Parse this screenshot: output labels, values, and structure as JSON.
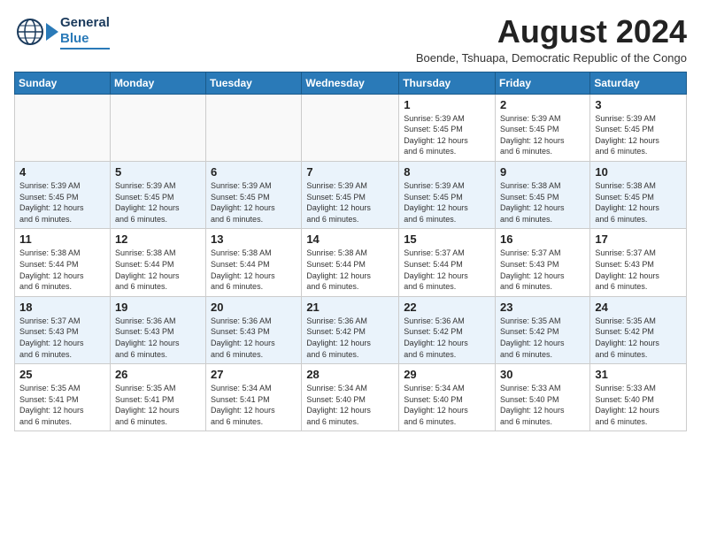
{
  "header": {
    "logo_general": "General",
    "logo_blue": "Blue",
    "month_title": "August 2024",
    "subtitle": "Boende, Tshuapa, Democratic Republic of the Congo"
  },
  "weekdays": [
    "Sunday",
    "Monday",
    "Tuesday",
    "Wednesday",
    "Thursday",
    "Friday",
    "Saturday"
  ],
  "weeks": [
    [
      {
        "day": "",
        "info": ""
      },
      {
        "day": "",
        "info": ""
      },
      {
        "day": "",
        "info": ""
      },
      {
        "day": "",
        "info": ""
      },
      {
        "day": "1",
        "info": "Sunrise: 5:39 AM\nSunset: 5:45 PM\nDaylight: 12 hours\nand 6 minutes."
      },
      {
        "day": "2",
        "info": "Sunrise: 5:39 AM\nSunset: 5:45 PM\nDaylight: 12 hours\nand 6 minutes."
      },
      {
        "day": "3",
        "info": "Sunrise: 5:39 AM\nSunset: 5:45 PM\nDaylight: 12 hours\nand 6 minutes."
      }
    ],
    [
      {
        "day": "4",
        "info": "Sunrise: 5:39 AM\nSunset: 5:45 PM\nDaylight: 12 hours\nand 6 minutes."
      },
      {
        "day": "5",
        "info": "Sunrise: 5:39 AM\nSunset: 5:45 PM\nDaylight: 12 hours\nand 6 minutes."
      },
      {
        "day": "6",
        "info": "Sunrise: 5:39 AM\nSunset: 5:45 PM\nDaylight: 12 hours\nand 6 minutes."
      },
      {
        "day": "7",
        "info": "Sunrise: 5:39 AM\nSunset: 5:45 PM\nDaylight: 12 hours\nand 6 minutes."
      },
      {
        "day": "8",
        "info": "Sunrise: 5:39 AM\nSunset: 5:45 PM\nDaylight: 12 hours\nand 6 minutes."
      },
      {
        "day": "9",
        "info": "Sunrise: 5:38 AM\nSunset: 5:45 PM\nDaylight: 12 hours\nand 6 minutes."
      },
      {
        "day": "10",
        "info": "Sunrise: 5:38 AM\nSunset: 5:45 PM\nDaylight: 12 hours\nand 6 minutes."
      }
    ],
    [
      {
        "day": "11",
        "info": "Sunrise: 5:38 AM\nSunset: 5:44 PM\nDaylight: 12 hours\nand 6 minutes."
      },
      {
        "day": "12",
        "info": "Sunrise: 5:38 AM\nSunset: 5:44 PM\nDaylight: 12 hours\nand 6 minutes."
      },
      {
        "day": "13",
        "info": "Sunrise: 5:38 AM\nSunset: 5:44 PM\nDaylight: 12 hours\nand 6 minutes."
      },
      {
        "day": "14",
        "info": "Sunrise: 5:38 AM\nSunset: 5:44 PM\nDaylight: 12 hours\nand 6 minutes."
      },
      {
        "day": "15",
        "info": "Sunrise: 5:37 AM\nSunset: 5:44 PM\nDaylight: 12 hours\nand 6 minutes."
      },
      {
        "day": "16",
        "info": "Sunrise: 5:37 AM\nSunset: 5:43 PM\nDaylight: 12 hours\nand 6 minutes."
      },
      {
        "day": "17",
        "info": "Sunrise: 5:37 AM\nSunset: 5:43 PM\nDaylight: 12 hours\nand 6 minutes."
      }
    ],
    [
      {
        "day": "18",
        "info": "Sunrise: 5:37 AM\nSunset: 5:43 PM\nDaylight: 12 hours\nand 6 minutes."
      },
      {
        "day": "19",
        "info": "Sunrise: 5:36 AM\nSunset: 5:43 PM\nDaylight: 12 hours\nand 6 minutes."
      },
      {
        "day": "20",
        "info": "Sunrise: 5:36 AM\nSunset: 5:43 PM\nDaylight: 12 hours\nand 6 minutes."
      },
      {
        "day": "21",
        "info": "Sunrise: 5:36 AM\nSunset: 5:42 PM\nDaylight: 12 hours\nand 6 minutes."
      },
      {
        "day": "22",
        "info": "Sunrise: 5:36 AM\nSunset: 5:42 PM\nDaylight: 12 hours\nand 6 minutes."
      },
      {
        "day": "23",
        "info": "Sunrise: 5:35 AM\nSunset: 5:42 PM\nDaylight: 12 hours\nand 6 minutes."
      },
      {
        "day": "24",
        "info": "Sunrise: 5:35 AM\nSunset: 5:42 PM\nDaylight: 12 hours\nand 6 minutes."
      }
    ],
    [
      {
        "day": "25",
        "info": "Sunrise: 5:35 AM\nSunset: 5:41 PM\nDaylight: 12 hours\nand 6 minutes."
      },
      {
        "day": "26",
        "info": "Sunrise: 5:35 AM\nSunset: 5:41 PM\nDaylight: 12 hours\nand 6 minutes."
      },
      {
        "day": "27",
        "info": "Sunrise: 5:34 AM\nSunset: 5:41 PM\nDaylight: 12 hours\nand 6 minutes."
      },
      {
        "day": "28",
        "info": "Sunrise: 5:34 AM\nSunset: 5:40 PM\nDaylight: 12 hours\nand 6 minutes."
      },
      {
        "day": "29",
        "info": "Sunrise: 5:34 AM\nSunset: 5:40 PM\nDaylight: 12 hours\nand 6 minutes."
      },
      {
        "day": "30",
        "info": "Sunrise: 5:33 AM\nSunset: 5:40 PM\nDaylight: 12 hours\nand 6 minutes."
      },
      {
        "day": "31",
        "info": "Sunrise: 5:33 AM\nSunset: 5:40 PM\nDaylight: 12 hours\nand 6 minutes."
      }
    ]
  ]
}
